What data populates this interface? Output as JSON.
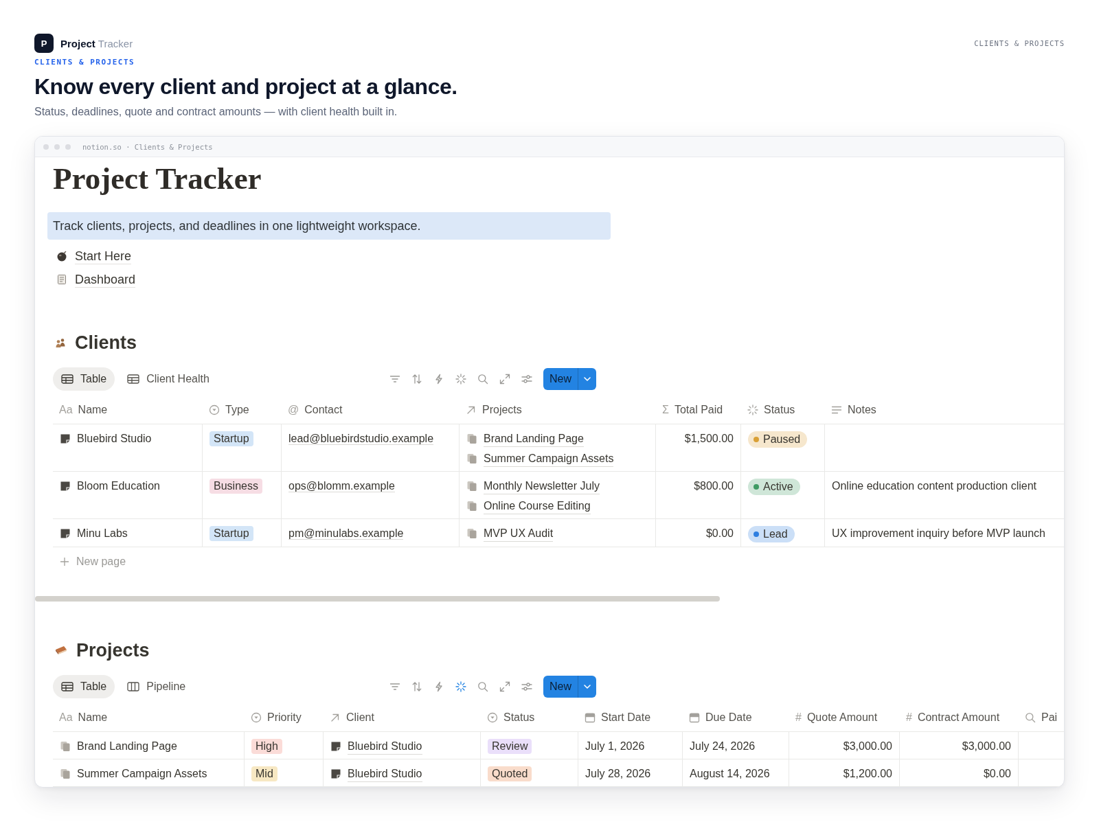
{
  "header": {
    "logo": "P",
    "brand": "Project",
    "brand_suffix": "Tracker",
    "section_label": "CLIENTS & PROJECTS",
    "eyebrow": "CLIENTS & PROJECTS",
    "headline": "Know every client and project at a glance.",
    "subtitle": "Status, deadlines, quote and contract amounts — with client health built in."
  },
  "browser": {
    "address": "notion.so · Clients & Projects"
  },
  "page": {
    "title": "Project Tracker",
    "callout": "Track clients, projects, and deadlines in one lightweight workspace.",
    "links": [
      {
        "kind": "guide",
        "label": "Start Here"
      },
      {
        "kind": "dashboard",
        "label": "Dashboard"
      }
    ]
  },
  "databases": [
    {
      "kind": "clients",
      "title": "Clients",
      "views": [
        {
          "kind": "table",
          "label": "Table",
          "selected": true
        },
        {
          "kind": "table",
          "label": "Client Health",
          "selected": false
        }
      ],
      "tools": [
        {
          "kind": "filter",
          "active": false
        },
        {
          "kind": "sort",
          "active": false
        },
        {
          "kind": "automation",
          "active": false
        },
        {
          "kind": "ai",
          "active": false
        },
        {
          "kind": "search",
          "active": false
        },
        {
          "kind": "expand",
          "active": false
        },
        {
          "kind": "settings",
          "active": false
        }
      ],
      "new_button": "New",
      "columns": [
        {
          "kind": "title",
          "glyph": "Aa",
          "label": "Name"
        },
        {
          "kind": "select",
          "label": "Type"
        },
        {
          "kind": "email",
          "glyph": "@",
          "label": "Contact"
        },
        {
          "kind": "relation",
          "label": "Projects"
        },
        {
          "kind": "formula",
          "glyph": "Σ",
          "label": "Total Paid"
        },
        {
          "kind": "status",
          "label": "Status"
        },
        {
          "kind": "text",
          "label": "Notes"
        }
      ],
      "rows": [
        {
          "kind": "client",
          "cells": [
            "Bluebird Studio",
            {
              "label": "Startup",
              "color": "#d3e5f7"
            },
            "lead@bluebirdstudio.example",
            [
              {
                "kind": "project",
                "label": "Brand Landing Page"
              },
              {
                "kind": "project",
                "label": "Summer Campaign Assets"
              }
            ],
            "$1,500.00",
            {
              "label": "Paused",
              "color": "#d9a036"
            },
            null
          ]
        },
        {
          "kind": "client",
          "cells": [
            "Bloom Education",
            {
              "label": "Business",
              "color": "#f6dde4"
            },
            "ops@blomm.example",
            [
              {
                "kind": "project",
                "label": "Monthly Newsletter July"
              },
              {
                "kind": "project",
                "label": "Online Course Editing"
              }
            ],
            "$800.00",
            {
              "label": "Active",
              "color": "#3f9b63"
            },
            "Online education content production client"
          ]
        },
        {
          "kind": "client",
          "cells": [
            "Minu Labs",
            {
              "label": "Startup",
              "color": "#d3e5f7"
            },
            "pm@minulabs.example",
            [
              {
                "kind": "project",
                "label": "MVP UX Audit"
              }
            ],
            "$0.00",
            {
              "label": "Lead",
              "color": "#2f7fe0"
            },
            "UX improvement inquiry before MVP launch"
          ]
        }
      ],
      "new_row": "New page"
    },
    {
      "kind": "projects",
      "title": "Projects",
      "views": [
        {
          "kind": "table",
          "label": "Table",
          "selected": true
        },
        {
          "kind": "board",
          "label": "Pipeline",
          "selected": false
        }
      ],
      "tools": [
        {
          "kind": "filter",
          "active": false
        },
        {
          "kind": "sort",
          "active": false
        },
        {
          "kind": "automation",
          "active": false
        },
        {
          "kind": "ai",
          "active": true
        },
        {
          "kind": "search",
          "active": false
        },
        {
          "kind": "expand",
          "active": false
        },
        {
          "kind": "settings",
          "active": false
        }
      ],
      "new_button": "New",
      "columns": [
        {
          "kind": "title",
          "glyph": "Aa",
          "label": "Name"
        },
        {
          "kind": "select",
          "label": "Priority"
        },
        {
          "kind": "relation",
          "label": "Client"
        },
        {
          "kind": "select",
          "label": "Status"
        },
        {
          "kind": "date",
          "label": "Start Date"
        },
        {
          "kind": "date",
          "label": "Due Date"
        },
        {
          "kind": "number",
          "glyph": "#",
          "label": "Quote Amount"
        },
        {
          "kind": "number",
          "glyph": "#",
          "label": "Contract Amount"
        },
        {
          "kind": "rollup",
          "label": "Pai"
        }
      ],
      "rows": [
        {
          "kind": "project",
          "cells": [
            "Brand Landing Page",
            {
              "label": "High",
              "color": "#fbdcd8"
            },
            [
              {
                "kind": "client",
                "label": "Bluebird Studio"
              }
            ],
            {
              "label": "Review",
              "color": "#eadffa"
            },
            "July 1, 2026",
            "July 24, 2026",
            "$3,000.00",
            "$3,000.00",
            null
          ]
        },
        {
          "kind": "project",
          "cells": [
            "Summer Campaign Assets",
            {
              "label": "Mid",
              "color": "#f7e8c3"
            },
            [
              {
                "kind": "client",
                "label": "Bluebird Studio"
              }
            ],
            {
              "label": "Quoted",
              "color": "#f9dccb"
            },
            "July 28, 2026",
            "August 14, 2026",
            "$1,200.00",
            "$0.00",
            null
          ]
        }
      ]
    }
  ]
}
